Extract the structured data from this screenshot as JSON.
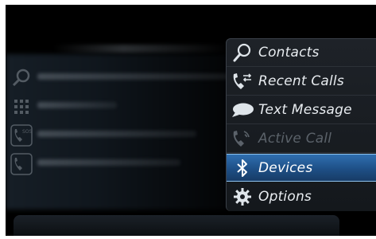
{
  "menu": {
    "items": [
      {
        "label": "Contacts",
        "icon": "search-icon",
        "state": "normal"
      },
      {
        "label": "Recent Calls",
        "icon": "phone-arrows-icon",
        "state": "normal"
      },
      {
        "label": "Text Message",
        "icon": "speech-bubble-icon",
        "state": "normal"
      },
      {
        "label": "Active Call",
        "icon": "phone-active-icon",
        "state": "disabled"
      },
      {
        "label": "Devices",
        "icon": "bluetooth-icon",
        "state": "selected"
      },
      {
        "label": "Options",
        "icon": "gear-icon",
        "state": "normal"
      }
    ]
  },
  "background_list": {
    "icon_labels": {
      "sos": "SOS"
    }
  },
  "colors": {
    "selected_bg": "#2f6fb0",
    "menu_text": "#e8ecf0",
    "disabled_text": "#5b626a",
    "accent": "#6fd3ff"
  }
}
